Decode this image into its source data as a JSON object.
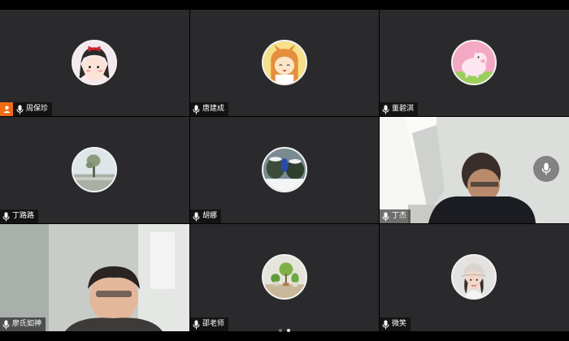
{
  "participants": [
    {
      "name": "周保珍",
      "avatar": "cartoon-girl-avatar",
      "host": true
    },
    {
      "name": "唐建成",
      "avatar": "anime-girl-avatar",
      "host": false
    },
    {
      "name": "董碧淇",
      "avatar": "pink-pig-avatar",
      "host": false
    },
    {
      "name": "丁路路",
      "avatar": "tree-landscape-avatar",
      "host": false
    },
    {
      "name": "胡娜",
      "avatar": "snowy-garden-avatar",
      "host": false
    },
    {
      "name": "丁杰",
      "avatar": "camera-video",
      "host": false
    },
    {
      "name": "廖氏如神",
      "avatar": "camera-video",
      "host": false
    },
    {
      "name": "邵老师",
      "avatar": "plants-avatar",
      "host": false
    },
    {
      "name": "微笑",
      "avatar": "woman-cap-avatar",
      "host": false
    }
  ],
  "pagination": {
    "pages": 2,
    "current": 2
  },
  "colors": {
    "tile_bg": "#2a2a2d",
    "active_speaker_border": "#20c060",
    "host_badge": "#f06b12"
  }
}
